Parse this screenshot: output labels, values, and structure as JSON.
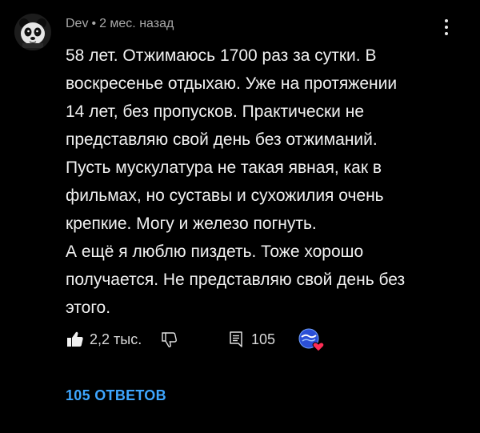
{
  "comment": {
    "author": "Dev",
    "separator": "•",
    "timestamp": "2 мес. назад",
    "lines": [
      "58 лет. Отжимаюсь 1700 раз за сутки. В",
      "воскресенье отдыхаю. Уже на протяжении",
      "14 лет, без пропусков. Практически не",
      "представляю свой день без отжиманий.",
      "Пусть мускулатура не такая явная, как в",
      "фильмах, но суставы и сухожилия очень",
      "крепкие. Могу и железо погнуть.",
      "А ещё я люблю пиздеть. Тоже хорошо",
      "получается. Не представляю свой день без",
      "этого."
    ],
    "likes": "2,2 тыс.",
    "replies_count": "105",
    "replies_link": "105 ОТВЕТОВ"
  },
  "icons": {
    "avatar": "panda-avatar-icon",
    "more": "more-vertical-icon",
    "like": "thumbs-up-filled-icon",
    "dislike": "thumbs-down-outline-icon",
    "reply": "reply-comment-icon",
    "creator_heart": "creator-heart-icon"
  },
  "colors": {
    "background": "#000000",
    "text": "#f1f1f1",
    "meta": "#a9a9a9",
    "link": "#3ea6ff",
    "heart": "#ff2d55"
  }
}
